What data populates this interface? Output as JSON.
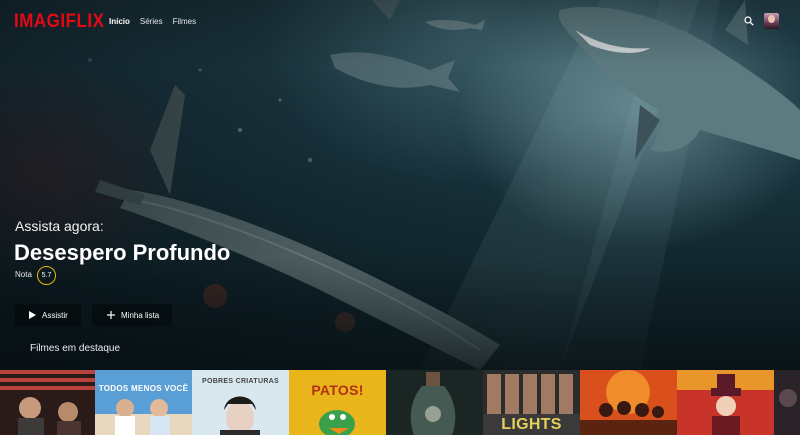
{
  "app": {
    "logo": "IMAGIFLIX",
    "nav": [
      "Início",
      "Séries",
      "Filmes"
    ]
  },
  "hero": {
    "eyebrow": "Assista agora:",
    "title": "Desespero Profundo",
    "rating_label": "Nota",
    "rating_value": "5.7",
    "buttons": {
      "watch": "Assistir",
      "list": "Minha lista"
    }
  },
  "section": {
    "title": "Filmes em destaque"
  },
  "posters": [
    {
      "title": "",
      "colors": [
        "#b8433c",
        "#e8e0d8"
      ]
    },
    {
      "title": "TODOS MENOS VOCÊ",
      "colors": [
        "#5a9ed6",
        "#f0e8d8"
      ]
    },
    {
      "title": "POBRES CRIATURAS",
      "colors": [
        "#cfe3ee",
        "#e9e9e9"
      ]
    },
    {
      "title": "PATOS!",
      "colors": [
        "#e8b51a",
        "#f4d84a"
      ]
    },
    {
      "title": "",
      "colors": [
        "#20302e",
        "#4a6058"
      ]
    },
    {
      "title": "LIGHTS",
      "colors": [
        "#3a3a3a",
        "#d9c25a"
      ]
    },
    {
      "title": "",
      "colors": [
        "#d9501c",
        "#f08c2a"
      ]
    },
    {
      "title": "",
      "colors": [
        "#c8342a",
        "#e8962a"
      ]
    },
    {
      "title": "",
      "colors": [
        "#2a2428",
        "#5a4a50"
      ]
    }
  ],
  "colors": {
    "brand": "#e50914",
    "rating_ring": "#e8b613"
  }
}
